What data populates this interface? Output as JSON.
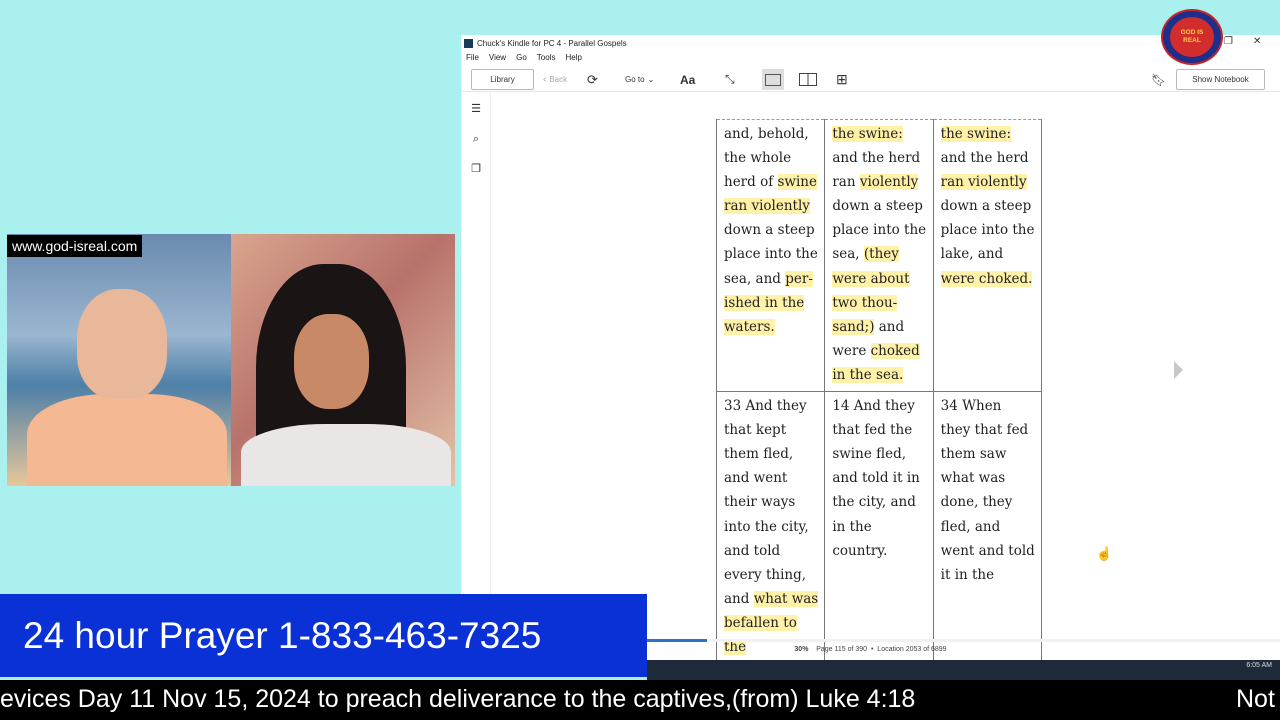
{
  "window": {
    "title": "Chuck's Kindle for PC 4 - Parallel Gospels",
    "minimize": "—",
    "maximize": "❐",
    "close": "✕"
  },
  "menu": [
    "File",
    "View",
    "Go",
    "Tools",
    "Help"
  ],
  "toolbar": {
    "library": "Library",
    "back": "Back",
    "goto": "Go to",
    "font": "Aa",
    "show_notebook": "Show Notebook"
  },
  "book_table": {
    "rows": [
      [
        [
          [
            "and, behold, the whole herd of ",
            false
          ],
          [
            "swine ran violently",
            true
          ],
          [
            " down a steep place into the sea, and ",
            false
          ],
          [
            "per-ished in the waters.",
            true
          ]
        ],
        [
          [
            "the swine:",
            true
          ],
          [
            " and the herd ran ",
            false
          ],
          [
            "violently",
            true
          ],
          [
            " down a steep place into the sea,  ",
            false
          ],
          [
            "(they were about two thou-sand;)",
            true
          ],
          [
            " and were ",
            false
          ],
          [
            "choked in the sea.",
            true
          ]
        ],
        [
          [
            "the swine:",
            true
          ],
          [
            " and the herd ",
            false
          ],
          [
            "ran violently",
            true
          ],
          [
            " down a steep place into the lake, and ",
            false
          ],
          [
            "were choked.",
            true
          ]
        ]
      ],
      [
        [
          [
            "33 And they that kept them fled, and went their ways into the city, and told every thing, and ",
            false
          ],
          [
            "what was befallen to the",
            true
          ]
        ],
        [
          [
            "14 And they that fed the swine fled, and told it in the city, and in the country.",
            false
          ]
        ],
        [
          [
            "34 When they that fed them saw what was done, they fled, and went and told it in the",
            false
          ]
        ]
      ]
    ]
  },
  "status": {
    "percent": "30%",
    "page": "Page 115 of 390",
    "location": "Location 2053 of 6899",
    "progress_fraction": 0.3
  },
  "logo": {
    "text": "GOD IS REAL"
  },
  "video": {
    "site_label": "www.god-isreal.com"
  },
  "banner": {
    "prayer": "24 hour Prayer 1-833-463-7325"
  },
  "taskbar": {
    "time": "6:05 AM"
  },
  "ticker": {
    "text": "evices Day 11 Nov 15, 2024 to preach deliverance to the captives,(from) Luke 4:18",
    "next": "Not"
  },
  "colors": {
    "background": "#a9f0ee",
    "highlight": "#fff2a8",
    "banner": "#0a31d6",
    "progress": "#2b73c9"
  }
}
